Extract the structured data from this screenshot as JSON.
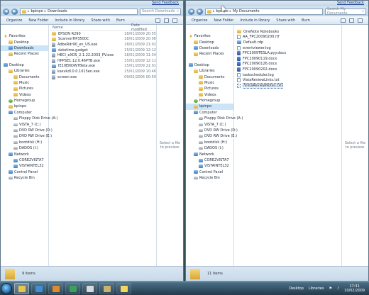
{
  "left_window": {
    "feedback_link": "Send Feedback",
    "breadcrumb": [
      "bpinpo",
      "Downloads"
    ],
    "search_placeholder": "Search Downloads",
    "toolbar": {
      "organize": "Organize",
      "new_folder": "New Folder",
      "include_in_library": "Include in library",
      "share_with": "Share with",
      "burn": "Burn"
    },
    "columns": {
      "name": "Name",
      "date_modified": "Date modified"
    },
    "files": [
      {
        "name": "EPSON R290",
        "date": "18/01/2009 20:55",
        "icon": "folder-icon",
        "selected": false
      },
      {
        "name": "ScannerHP3500C",
        "date": "18/01/2009 20:06",
        "icon": "folder-icon",
        "selected": false
      },
      {
        "name": "AdbeRdr90_en_US.exe",
        "date": "18/01/2009 21:02",
        "icon": "adobe-reader-icon",
        "selected": false
      },
      {
        "name": "datetime.gadget",
        "date": "15/01/2009 12:12",
        "icon": "gadget-icon",
        "selected": false
      },
      {
        "name": "HECI_eXOS_2.1.22.2033_PV.exe",
        "date": "18/01/2009 11:34",
        "icon": "installer-icon",
        "selected": false
      },
      {
        "name": "HPPSE1.12.0.46PTB.exe",
        "date": "15/01/2009 12:11",
        "icon": "installer-icon",
        "selected": false
      },
      {
        "name": "IE10ENOW7Beta.exe",
        "date": "15/01/2009 21:01",
        "icon": "internet-explorer-icon",
        "selected": false
      },
      {
        "name": "kasvkdl.0.0.1015en.exe",
        "date": "15/01/2009 10:46",
        "icon": "installer-icon",
        "selected": false
      },
      {
        "name": "screen.exe",
        "date": "09/02/2006 00:50",
        "icon": "installer-icon",
        "selected": false
      }
    ],
    "preview_text": "Select a file to preview.",
    "status": "9 items"
  },
  "right_window": {
    "feedback_link": "Send Feedback",
    "breadcrumb": [
      "bpinpo",
      "My Documents"
    ],
    "search_placeholder": "Search My Documents",
    "toolbar": {
      "organize": "Organize",
      "new_folder": "New Folder",
      "include_in_library": "Include in library",
      "share_with": "Share with",
      "burn": "Burn"
    },
    "files": [
      {
        "name": "OneNote Notebooks",
        "icon": "folder-icon",
        "selected": false
      },
      {
        "name": "AA_FPC20090200.rtf",
        "icon": "document-icon",
        "selected": false
      },
      {
        "name": "Default.rdp",
        "icon": "remote-desktop-icon",
        "selected": false
      },
      {
        "name": "eventviewer.log",
        "icon": "text-file-icon",
        "selected": false
      },
      {
        "name": "FPC2009TESLA.pyy.docx",
        "icon": "word-document-icon",
        "selected": false
      },
      {
        "name": "FPC20090119.docx",
        "icon": "word-document-icon",
        "selected": false
      },
      {
        "name": "FPC20090126.docx",
        "icon": "word-document-icon",
        "selected": false
      },
      {
        "name": "FPC20090202.docx",
        "icon": "word-document-icon",
        "selected": false
      },
      {
        "name": "taskscheduler.log",
        "icon": "text-file-icon",
        "selected": false
      },
      {
        "name": "VistaReviewLinks.txt",
        "icon": "text-file-icon",
        "selected": false
      },
      {
        "name": "VistaReviewNotes.txt",
        "icon": "text-file-icon",
        "selected": true
      }
    ],
    "preview_text": "Select a file to preview.",
    "status": "11 items"
  },
  "nav_pane": {
    "favorites": {
      "label": "Favorites",
      "items": [
        "Desktop",
        "Downloads",
        "Recent Places"
      ]
    },
    "desktop": {
      "label": "Desktop"
    },
    "libraries": {
      "label": "Libraries",
      "items": [
        "Documents",
        "Music",
        "Pictures",
        "Videos"
      ]
    },
    "homegroup": "Homegroup",
    "user": "bpinpo",
    "computer": {
      "label": "Computer",
      "items": [
        "Floppy Disk Drive (A:)",
        "VISTA_7 (C:)",
        "DVD RW Drive (D:)",
        "DVD RW Drive (E:)",
        "bootdisk (H:)",
        "DADOS (I:)"
      ]
    },
    "network": {
      "label": "Network",
      "items": [
        "CORE2VISTA7",
        "VISTAINTEL32"
      ]
    },
    "control_panel": "Control Panel",
    "recycle_bin": "Recycle Bin"
  },
  "taskbar": {
    "apps": [
      "windows-explorer-icon",
      "internet-explorer-icon",
      "windows-media-player-icon",
      "media-center-icon",
      "calendar-icon",
      "notes-icon",
      "sticky-notes-icon"
    ],
    "tray_desktop": "Desktop",
    "tray_libraries": "Libraries",
    "time": "17:31",
    "date": "10/02/2009"
  },
  "colors": {
    "window_frame": "#c9dbe9",
    "selection": "#cce4f7",
    "taskbar": "#23394b",
    "wallpaper": "#4a6e78"
  }
}
